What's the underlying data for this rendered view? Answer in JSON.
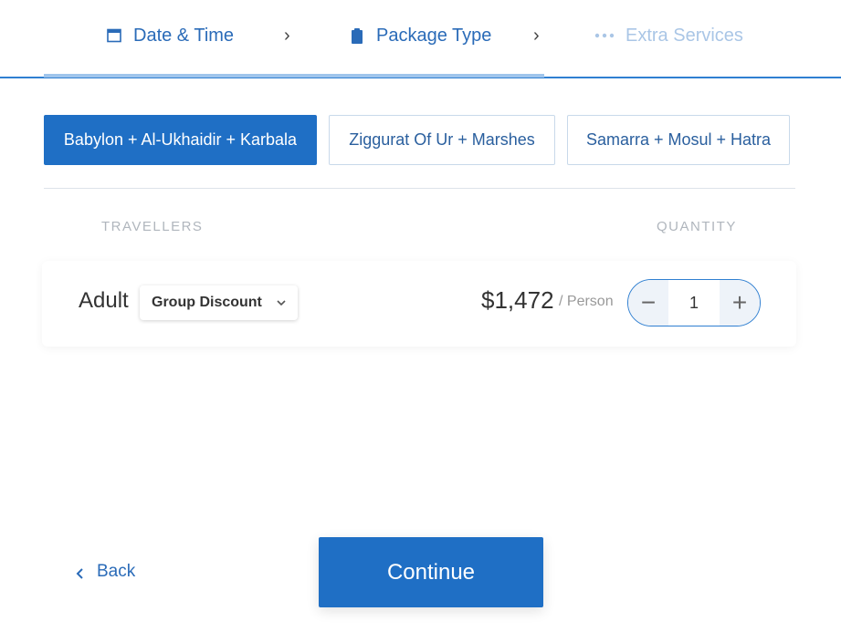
{
  "steps": {
    "date_time": "Date & Time",
    "package_type": "Package Type",
    "extra_services": "Extra Services",
    "separator": "›"
  },
  "packages": [
    {
      "label": "Babylon + Al-Ukhaidir + Karbala",
      "active": true
    },
    {
      "label": "Ziggurat Of Ur + Marshes",
      "active": false
    },
    {
      "label": "Samarra + Mosul + Hatra",
      "active": false
    }
  ],
  "table": {
    "travellers_header": "TRAVELLERS",
    "quantity_header": "QUANTITY"
  },
  "traveller": {
    "type": "Adult",
    "discount_option": "Group Discount",
    "price": "$1,472",
    "unit": "/ Person",
    "quantity": "1",
    "minus": "−",
    "plus": "+"
  },
  "footer": {
    "back_label": "Back",
    "continue_label": "Continue"
  },
  "colors": {
    "accent": "#1f6fc5",
    "link": "#2a6bb8",
    "disabled": "#aac6e6"
  }
}
